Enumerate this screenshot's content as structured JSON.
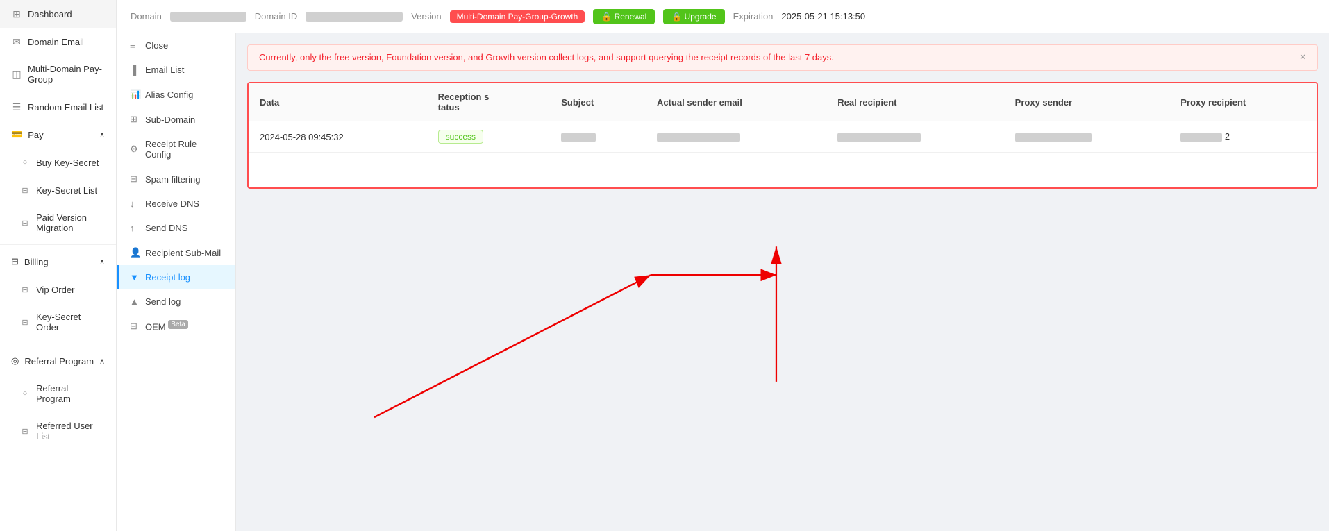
{
  "sidebar": {
    "items": [
      {
        "id": "dashboard",
        "label": "Dashboard",
        "icon": "⊞"
      },
      {
        "id": "domain-email",
        "label": "Domain Email",
        "icon": "✉"
      },
      {
        "id": "multi-domain",
        "label": "Multi-Domain Pay-Group",
        "icon": "◫"
      },
      {
        "id": "random-email",
        "label": "Random Email List",
        "icon": "☰"
      },
      {
        "id": "pay",
        "label": "Pay",
        "icon": "₿",
        "hasArrow": true,
        "expanded": true
      },
      {
        "id": "buy-key-secret",
        "label": "Buy Key-Secret",
        "icon": "○"
      },
      {
        "id": "key-secret-list",
        "label": "Key-Secret List",
        "icon": "⊟"
      },
      {
        "id": "paid-version",
        "label": "Paid Version Migration",
        "icon": "⊟"
      },
      {
        "id": "billing",
        "label": "Billing",
        "icon": "⊟",
        "hasArrow": true,
        "expanded": true
      },
      {
        "id": "vip-order",
        "label": "Vip Order",
        "icon": "⊟"
      },
      {
        "id": "key-secret-order",
        "label": "Key-Secret Order",
        "icon": "⊟"
      },
      {
        "id": "referral-program",
        "label": "Referral Program",
        "icon": "◎",
        "hasArrow": true,
        "expanded": true
      },
      {
        "id": "referral-program-sub",
        "label": "Referral Program",
        "icon": "○"
      },
      {
        "id": "referred-user-list",
        "label": "Referred User List",
        "icon": "⊟"
      }
    ]
  },
  "header": {
    "domain_label": "Domain",
    "domain_value": "██████████████",
    "domain_id_label": "Domain ID",
    "domain_id_value": "████████████████████",
    "version_label": "Version",
    "version_badge": "Multi-Domain Pay-Group-Growth",
    "renewal_label": "🔒 Renewal",
    "upgrade_label": "🔒 Upgrade",
    "expiration_label": "Expiration",
    "expiration_value": "2025-05-21 15:13:50"
  },
  "sub_sidebar": {
    "items": [
      {
        "id": "close",
        "label": "Close",
        "icon": "≡"
      },
      {
        "id": "email-list",
        "label": "Email List",
        "icon": "▐"
      },
      {
        "id": "alias-config",
        "label": "Alias Config",
        "icon": "📊"
      },
      {
        "id": "sub-domain",
        "label": "Sub-Domain",
        "icon": "⊞"
      },
      {
        "id": "receipt-rule",
        "label": "Receipt Rule Config",
        "icon": "⚙"
      },
      {
        "id": "spam-filtering",
        "label": "Spam filtering",
        "icon": "⊟"
      },
      {
        "id": "receive-dns",
        "label": "Receive DNS",
        "icon": "↓"
      },
      {
        "id": "send-dns",
        "label": "Send DNS",
        "icon": "↑"
      },
      {
        "id": "recipient-sub-mail",
        "label": "Recipient Sub-Mail",
        "icon": "👤"
      },
      {
        "id": "receipt-log",
        "label": "Receipt log",
        "icon": "▼",
        "active": true
      },
      {
        "id": "send-log",
        "label": "Send log",
        "icon": "▲"
      },
      {
        "id": "oem",
        "label": "OEM Beta",
        "icon": "⊟"
      }
    ]
  },
  "alert": {
    "text": "Currently, only the free version, Foundation version, and Growth version collect logs, and support querying the receipt records of the last 7 days."
  },
  "table": {
    "columns": [
      {
        "id": "data",
        "label": "Data"
      },
      {
        "id": "reception-status",
        "label": "Reception s\ntatus"
      },
      {
        "id": "subject",
        "label": "Subject"
      },
      {
        "id": "actual-sender",
        "label": "Actual sender email"
      },
      {
        "id": "real-recipient",
        "label": "Real recipient"
      },
      {
        "id": "proxy-sender",
        "label": "Proxy sender"
      },
      {
        "id": "proxy-recipient",
        "label": "Proxy recipient"
      }
    ],
    "rows": [
      {
        "data": "2024-05-28 09:45:32",
        "reception_status": "success",
        "subject": "████",
        "actual_sender": "████████████████",
        "real_recipient": "████████████████",
        "proxy_sender": "████████████████",
        "proxy_recipient": "2"
      }
    ]
  }
}
